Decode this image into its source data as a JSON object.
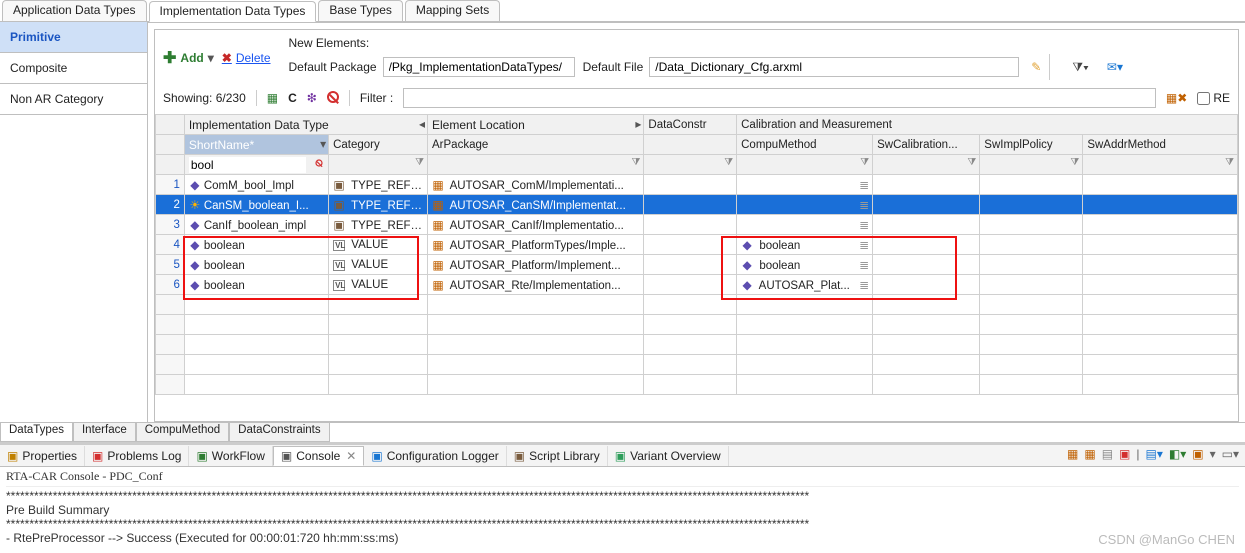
{
  "top_tabs": [
    "Application Data Types",
    "Implementation Data Types",
    "Base Types",
    "Mapping Sets"
  ],
  "top_active": 1,
  "left_nav": [
    "Primitive",
    "Composite",
    "Non AR Category"
  ],
  "left_active": 0,
  "toolbar": {
    "add": "Add",
    "delete": "Delete",
    "new_elements_label": "New Elements:",
    "default_package_label": "Default Package",
    "default_package_value": "/Pkg_ImplementationDataTypes/",
    "default_file_label": "Default File",
    "default_file_value": "/Data_Dictionary_Cfg.arxml"
  },
  "showing": {
    "label": "Showing:",
    "value": "6/230",
    "filter_label": "Filter :",
    "re_label": "RE"
  },
  "grid": {
    "groups": [
      {
        "label": "",
        "span": 1
      },
      {
        "label": "Implementation Data Type",
        "span": 2
      },
      {
        "label": "Element Location",
        "span": 1
      },
      {
        "label": "DataConstr",
        "span": 1
      },
      {
        "label": "Calibration and Measurement",
        "span": 4
      }
    ],
    "cols": [
      "ShortName*",
      "Category",
      "ArPackage",
      "",
      "CompuMethod",
      "SwCalibration...",
      "SwImplPolicy",
      "SwAddrMethod"
    ],
    "filter_row": {
      "shortname": "bool"
    },
    "rows": [
      {
        "n": 1,
        "short": "ComM_bool_Impl",
        "sicon": "dia",
        "cat": "TYPE_REFE...",
        "cicon": "pkg",
        "pkg": "AUTOSAR_ComM/Implementati...",
        "compu": "",
        "sel": false
      },
      {
        "n": 2,
        "short": "CanSM_boolean_I...",
        "sicon": "sun",
        "cat": "TYPE_REFE...",
        "cicon": "pkg",
        "pkg": "AUTOSAR_CanSM/Implementat...",
        "compu": "",
        "sel": true
      },
      {
        "n": 3,
        "short": "CanIf_boolean_impl",
        "sicon": "dia",
        "cat": "TYPE_REFE...",
        "cicon": "pkg",
        "pkg": "AUTOSAR_CanIf/Implementatio...",
        "compu": "",
        "sel": false
      },
      {
        "n": 4,
        "short": "boolean",
        "sicon": "dia",
        "cat": "VALUE",
        "cicon": "vl",
        "pkg": "AUTOSAR_PlatformTypes/Imple...",
        "compu": "boolean",
        "sel": false
      },
      {
        "n": 5,
        "short": "boolean",
        "sicon": "dia",
        "cat": "VALUE",
        "cicon": "vl",
        "pkg": "AUTOSAR_Platform/Implement...",
        "compu": "boolean",
        "sel": false
      },
      {
        "n": 6,
        "short": "boolean",
        "sicon": "dia",
        "cat": "VALUE",
        "cicon": "vl",
        "pkg": "AUTOSAR_Rte/Implementation...",
        "compu": "AUTOSAR_Plat...",
        "sel": false
      }
    ]
  },
  "bottom_tabs": [
    "DataTypes",
    "Interface",
    "CompuMethod",
    "DataConstraints"
  ],
  "bottom_active": 0,
  "view_tabs": [
    {
      "label": "Properties",
      "icon": "#c08000"
    },
    {
      "label": "Problems Log",
      "icon": "#d32f2f"
    },
    {
      "label": "WorkFlow",
      "icon": "#2e7d32"
    },
    {
      "label": "Console",
      "icon": "#555",
      "active": true,
      "closable": true
    },
    {
      "label": "Configuration Logger",
      "icon": "#1976d2"
    },
    {
      "label": "Script Library",
      "icon": "#7a5c3e"
    },
    {
      "label": "Variant Overview",
      "icon": "#2e9e5b"
    }
  ],
  "console": {
    "title": "RTA-CAR Console - PDC_Conf",
    "lines": [
      "****************************************************************************************************************************************************************************",
      "Pre Build Summary",
      "****************************************************************************************************************************************************************************",
      "- RtePreProcessor --> Success (Executed for 00:00:01:720 hh:mm:ss:ms)"
    ]
  },
  "watermark": "CSDN @ManGo CHEN"
}
